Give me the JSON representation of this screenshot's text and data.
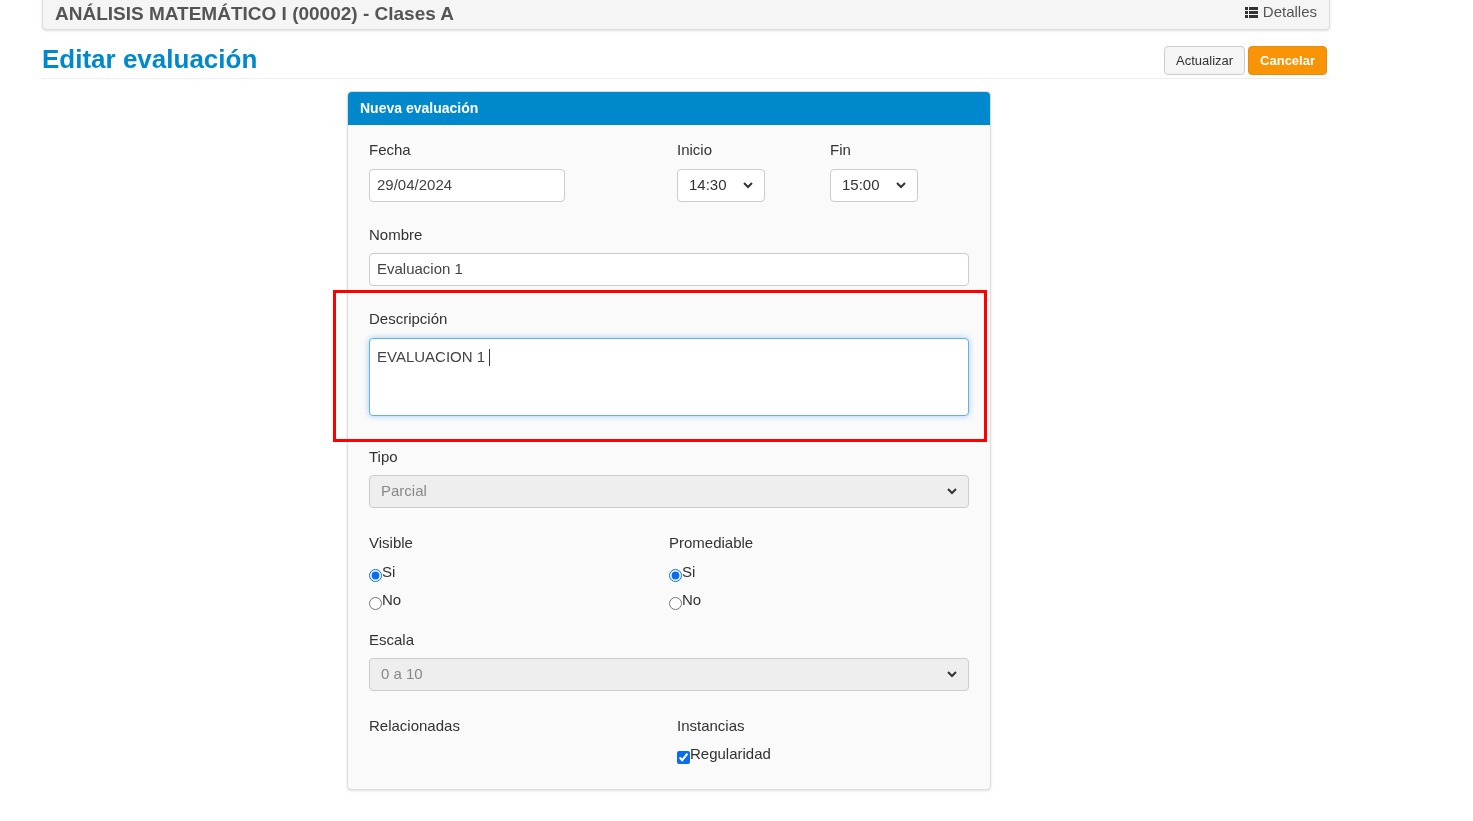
{
  "course_bar": {
    "title": "ANÁLISIS MATEMÁTICO I (00002) - Clases A",
    "details_link": "Detalles"
  },
  "page_title": "Editar evaluación",
  "buttons": [
    {
      "label": "Actualizar",
      "kind": "default"
    },
    {
      "label": "Cancelar",
      "kind": "warning"
    }
  ],
  "panel": {
    "title": "Nueva evaluación",
    "fecha": {
      "label": "Fecha",
      "value": "29/04/2024"
    },
    "inicio": {
      "label": "Inicio",
      "value": "14:30"
    },
    "fin": {
      "label": "Fin",
      "value": "15:00"
    },
    "nombre": {
      "label": "Nombre",
      "value": "Evaluacion 1"
    },
    "descripcion": {
      "label": "Descripción",
      "value": "EVALUACION 1 ",
      "focused": true,
      "highlighted": true
    },
    "tipo": {
      "label": "Tipo",
      "value": "Parcial",
      "disabled": true
    },
    "radio_groups": [
      {
        "label": "Visible",
        "options": [
          {
            "label": "Si",
            "selected": true
          },
          {
            "label": "No",
            "selected": false
          }
        ]
      },
      {
        "label": "Promediable",
        "options": [
          {
            "label": "Si",
            "selected": true
          },
          {
            "label": "No",
            "selected": false
          }
        ]
      }
    ],
    "escala": {
      "label": "Escala",
      "value": "0 a 10",
      "disabled": true
    },
    "relacionadas": {
      "label": "Relacionadas"
    },
    "instancias": {
      "label": "Instancias",
      "options": [
        {
          "label": "Regularidad",
          "checked": true
        }
      ]
    }
  }
}
